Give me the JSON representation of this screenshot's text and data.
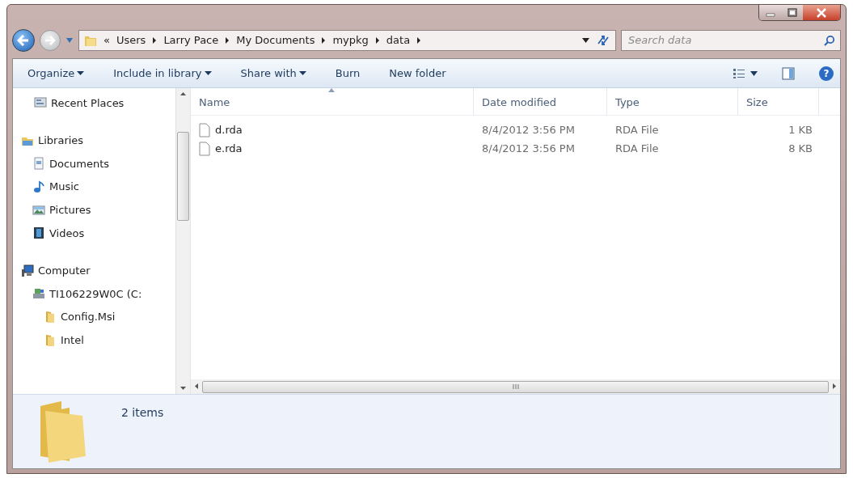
{
  "address": {
    "overflow": "«",
    "path": [
      "Users",
      "Larry Pace",
      "My Documents",
      "mypkg",
      "data"
    ]
  },
  "search": {
    "placeholder": "Search data"
  },
  "toolbar": [
    {
      "label": "Organize",
      "dropdown": true
    },
    {
      "label": "Include in library",
      "dropdown": true
    },
    {
      "label": "Share with",
      "dropdown": true
    },
    {
      "label": "Burn",
      "dropdown": false
    },
    {
      "label": "New folder",
      "dropdown": false
    }
  ],
  "help": {
    "label": "?"
  },
  "nav": [
    {
      "label": "Recent Places",
      "kind": "recent"
    },
    {
      "label": "Libraries",
      "kind": "library",
      "children": [
        {
          "label": "Documents",
          "kind": "documents"
        },
        {
          "label": "Music",
          "kind": "music"
        },
        {
          "label": "Pictures",
          "kind": "pictures"
        },
        {
          "label": "Videos",
          "kind": "videos"
        }
      ]
    },
    {
      "label": "Computer",
      "kind": "computer",
      "children": [
        {
          "label": "TI106229W0C (C:",
          "kind": "drive",
          "children": [
            {
              "label": "Config.Msi",
              "kind": "folder"
            },
            {
              "label": "Intel",
              "kind": "folder"
            }
          ]
        }
      ]
    }
  ],
  "columns": [
    {
      "label": "Name",
      "sorted": true
    },
    {
      "label": "Date modified",
      "sorted": false
    },
    {
      "label": "Type",
      "sorted": false
    },
    {
      "label": "Size",
      "sorted": false
    }
  ],
  "files": [
    {
      "name": "d.rda",
      "date": "8/4/2012 3:56 PM",
      "type": "RDA File",
      "size": "1 KB"
    },
    {
      "name": "e.rda",
      "date": "8/4/2012 3:56 PM",
      "type": "RDA File",
      "size": "8 KB"
    }
  ],
  "status": {
    "count": "2 items"
  }
}
